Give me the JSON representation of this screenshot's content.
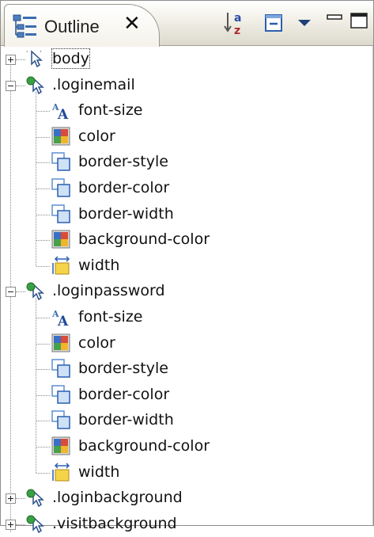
{
  "view": {
    "tab_label": "Outline",
    "close_glyph": "✕",
    "toolbar": [
      {
        "icon": "sort-alphabetical-icon",
        "name": "sort-button"
      },
      {
        "icon": "collapse-all-icon",
        "name": "collapse-all-button"
      },
      {
        "icon": "view-menu-icon",
        "name": "view-menu-button"
      },
      {
        "icon": "minimize-icon",
        "name": "minimize-button"
      },
      {
        "icon": "maximize-icon",
        "name": "maximize-button"
      }
    ]
  },
  "tree": {
    "rules": [
      {
        "label": "body",
        "selector_icon": "body-selector-icon",
        "expanded": false,
        "selected": true,
        "properties": []
      },
      {
        "label": ".loginemail",
        "selector_icon": "class-selector-icon",
        "expanded": true,
        "selected": false,
        "properties": [
          {
            "label": "font-size",
            "icon": "font-icon"
          },
          {
            "label": "color",
            "icon": "color-icon"
          },
          {
            "label": "border-style",
            "icon": "border-icon"
          },
          {
            "label": "border-color",
            "icon": "border-icon"
          },
          {
            "label": "border-width",
            "icon": "border-icon"
          },
          {
            "label": "background-color",
            "icon": "color-icon"
          },
          {
            "label": "width",
            "icon": "width-icon"
          }
        ]
      },
      {
        "label": ".loginpassword",
        "selector_icon": "class-selector-icon",
        "expanded": true,
        "selected": false,
        "properties": [
          {
            "label": "font-size",
            "icon": "font-icon"
          },
          {
            "label": "color",
            "icon": "color-icon"
          },
          {
            "label": "border-style",
            "icon": "border-icon"
          },
          {
            "label": "border-color",
            "icon": "border-icon"
          },
          {
            "label": "border-width",
            "icon": "border-icon"
          },
          {
            "label": "background-color",
            "icon": "color-icon"
          },
          {
            "label": "width",
            "icon": "width-icon"
          }
        ]
      },
      {
        "label": ".loginbackground",
        "selector_icon": "class-selector-icon",
        "expanded": false,
        "selected": false,
        "properties": []
      },
      {
        "label": ".visitbackground",
        "selector_icon": "class-selector-icon",
        "expanded": false,
        "selected": false,
        "properties": []
      }
    ]
  }
}
